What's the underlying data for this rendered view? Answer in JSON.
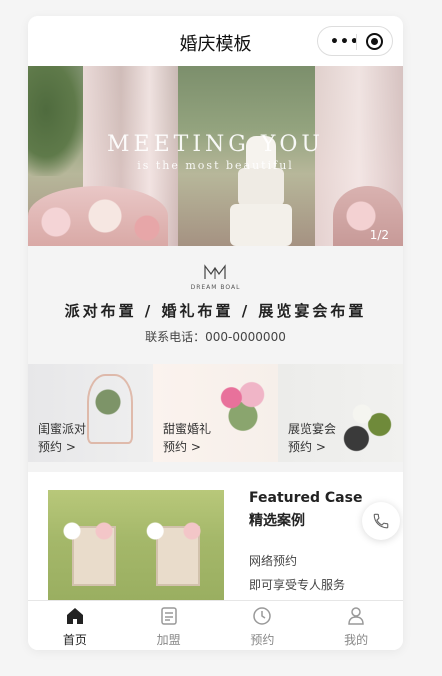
{
  "app": {
    "title": "婚庆模板"
  },
  "capsule": {
    "menu_icon": "more-dots-icon",
    "close_icon": "target-circle-icon"
  },
  "banner": {
    "title": "MEETING YOU",
    "subtitle": "is the most beautiful",
    "pager": "1/2"
  },
  "brand": {
    "logo_text": "DREAM BOAL",
    "services": "派对布置 / 婚礼布置 / 展览宴会布置",
    "phone": "联系电话：000-0000000"
  },
  "categories": [
    {
      "label": "闺蜜派对",
      "action": "预约 >"
    },
    {
      "label": "甜蜜婚礼",
      "action": "预约 >"
    },
    {
      "label": "展览宴会",
      "action": "预约 >"
    }
  ],
  "featured": {
    "title_en": "Featured Case",
    "title_cn": "精选案例",
    "line1": "网络预约",
    "line2": "即可享受专人服务"
  },
  "tabs": [
    {
      "label": "首页",
      "icon": "home-icon",
      "active": true
    },
    {
      "label": "加盟",
      "icon": "document-icon",
      "active": false
    },
    {
      "label": "预约",
      "icon": "clock-icon",
      "active": false
    },
    {
      "label": "我的",
      "icon": "user-icon",
      "active": false
    }
  ],
  "colors": {
    "accent": "#222222",
    "inactive": "#888888",
    "background": "#f5f5f5"
  }
}
